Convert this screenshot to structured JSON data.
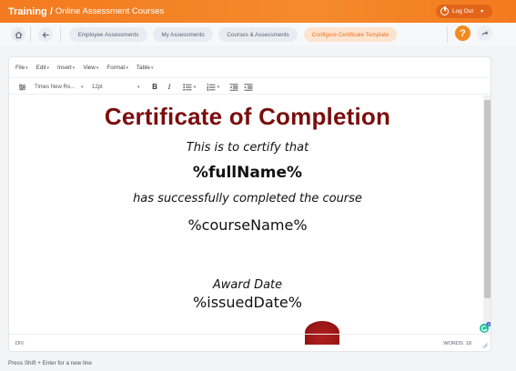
{
  "header": {
    "section": "Training /",
    "subtitle": "Online Assessment Courses",
    "logout_label": "Log Out",
    "caret": "▾"
  },
  "nav": {
    "tabs": [
      {
        "label": "Employee Assessments"
      },
      {
        "label": "My Assessments"
      },
      {
        "label": "Courses & Assessments"
      },
      {
        "label": "Configure Certificate Template"
      }
    ],
    "help_label": "?"
  },
  "editor": {
    "menus": [
      {
        "label": "File"
      },
      {
        "label": "Edit"
      },
      {
        "label": "Insert"
      },
      {
        "label": "View"
      },
      {
        "label": "Format"
      },
      {
        "label": "Table"
      }
    ],
    "menu_caret": "▾",
    "font_family": "Times New Ro...",
    "font_size": "12pt",
    "toolbar_caret": "▾"
  },
  "certificate": {
    "title": "Certificate of Completion",
    "intro": "This is to certify that",
    "name": "%fullName%",
    "completed": "has successfully completed the course",
    "course": "%courseName%",
    "award_label": "Award Date",
    "issued": "%issuedDate%",
    "title_color": "#7b0d0d"
  },
  "status": {
    "element_path": "DIV",
    "word_count": "WORDS: 18"
  },
  "footer": {
    "hint": "Press Shift + Enter for a new line"
  },
  "colors": {
    "accent": "#f47a1f",
    "active_tab_bg": "#fde4cf",
    "active_tab_text": "#e8722a"
  }
}
